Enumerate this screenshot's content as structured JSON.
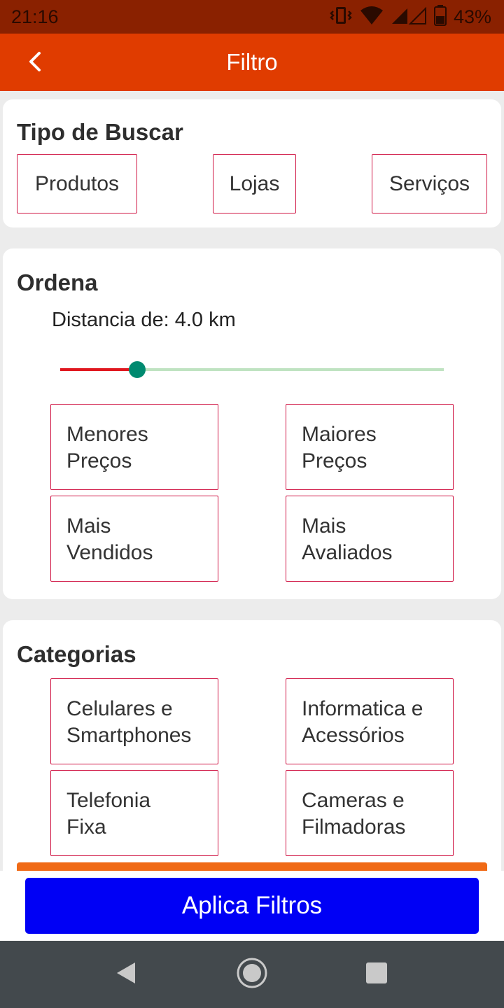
{
  "status": {
    "time": "21:16",
    "battery": "43%"
  },
  "appbar": {
    "title": "Filtro"
  },
  "tipo": {
    "title": "Tipo de Buscar",
    "options": [
      "Produtos",
      "Lojas",
      "Serviços"
    ]
  },
  "ordena": {
    "title": "Ordena",
    "distance_label": "Distancia de: 4.0 km",
    "slider_fraction": 0.2,
    "options": [
      {
        "line1": "Menores",
        "line2": "Preços"
      },
      {
        "line1": "Maiores",
        "line2": "Preços"
      },
      {
        "line1": "Mais",
        "line2": "Vendidos"
      },
      {
        "line1": "Mais",
        "line2": "Avaliados"
      }
    ]
  },
  "categorias": {
    "title": "Categorias",
    "options": [
      {
        "line1": "Celulares e",
        "line2": "Smartphones"
      },
      {
        "line1": "Informatica e",
        "line2": "Acessórios"
      },
      {
        "line1": "Telefonia",
        "line2": "Fixa"
      },
      {
        "line1": "Cameras e",
        "line2": "Filmadoras"
      }
    ]
  },
  "apply": {
    "label": "Aplica Filtros"
  },
  "colors": {
    "appbar": "#e03c00",
    "statusbar": "#8a2100",
    "chip_border": "#d01745",
    "apply_button": "#0000f5",
    "slider_active": "#e0171f",
    "slider_thumb": "#008a70",
    "slider_rest": "#bfe3c1"
  },
  "icons": {
    "back": "chevron-left-icon",
    "vibrate": "vibrate-icon",
    "wifi": "wifi-icon",
    "signal": "signal-icon",
    "battery": "battery-icon",
    "nav_back": "nav-back-icon",
    "nav_home": "nav-home-icon",
    "nav_recents": "nav-recents-icon"
  }
}
